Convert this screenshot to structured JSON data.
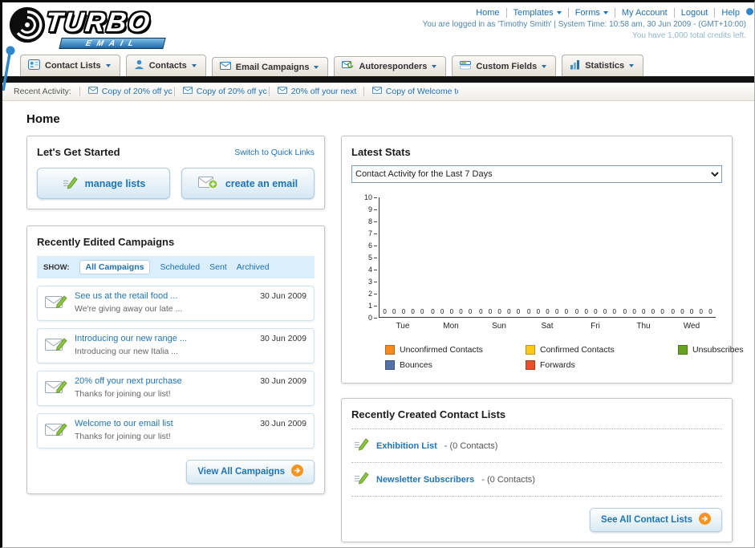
{
  "header": {
    "logo": {
      "title": "TURBO",
      "subtitle": "EMAIL"
    },
    "links": [
      {
        "label": "Home"
      },
      {
        "label": "Templates"
      },
      {
        "label": "Forms"
      },
      {
        "label": "My Account"
      },
      {
        "label": "Logout"
      },
      {
        "label": "Help"
      }
    ],
    "session_line": "You are logged in as 'Timothy Smith' | System Time: 10:58 am, 30 Jun 2009 - (GMT+10:00)",
    "credits_line": "You have 1,000 total credits left."
  },
  "nav": {
    "tabs": [
      {
        "label": "Contact Lists"
      },
      {
        "label": "Contacts"
      },
      {
        "label": "Email Campaigns"
      },
      {
        "label": "Autoresponders"
      },
      {
        "label": "Custom Fields"
      },
      {
        "label": "Statistics"
      }
    ]
  },
  "recent_activity": {
    "label": "Recent Activity:",
    "items": [
      {
        "label": "Copy of 20% off yc"
      },
      {
        "label": "Copy of 20% off yc"
      },
      {
        "label": "20% off your next"
      },
      {
        "label": "Copy of Welcome tc"
      }
    ]
  },
  "page": {
    "title": "Home"
  },
  "get_started": {
    "title": "Let's Get Started",
    "quick_links_label": "Switch to Quick Links",
    "manage_lists_label": "manage lists",
    "create_email_label": "create an email"
  },
  "campaigns": {
    "title": "Recently Edited Campaigns",
    "show_label": "SHOW:",
    "tabs": [
      {
        "label": "All Campaigns"
      },
      {
        "label": "Scheduled"
      },
      {
        "label": "Sent"
      },
      {
        "label": "Archived"
      }
    ],
    "items": [
      {
        "title": "See us at the retail food ...",
        "subtitle": "We're giving away our late ...",
        "date": "30 Jun 2009"
      },
      {
        "title": "Introducing our new range ...",
        "subtitle": "Introducing our new Italia ...",
        "date": "30 Jun 2009"
      },
      {
        "title": "20% off your next purchase",
        "subtitle": "Thanks for joining our list!",
        "date": "30 Jun 2009"
      },
      {
        "title": "Welcome to our email list",
        "subtitle": "Thanks for joining our list!",
        "date": "30 Jun 2009"
      }
    ],
    "view_all_label": "View All Campaigns"
  },
  "stats": {
    "title": "Latest Stats",
    "selected_option": "Contact Activity for the Last 7 Days",
    "chart_data": {
      "type": "bar",
      "title": "Contact Activity for the Last 7 Days",
      "categories": [
        "Tue",
        "Mon",
        "Sun",
        "Sat",
        "Fri",
        "Thu",
        "Wed"
      ],
      "series": [
        {
          "name": "Unconfirmed Contacts",
          "color": "#f68b1f",
          "values": [
            0,
            0,
            0,
            0,
            0,
            0,
            0
          ]
        },
        {
          "name": "Confirmed Contacts",
          "color": "#fdc716",
          "values": [
            0,
            0,
            0,
            0,
            0,
            0,
            0
          ]
        },
        {
          "name": "Unsubscribes",
          "color": "#66a321",
          "values": [
            0,
            0,
            0,
            0,
            0,
            0,
            0
          ]
        },
        {
          "name": "Bounces",
          "color": "#5470a8",
          "values": [
            0,
            0,
            0,
            0,
            0,
            0,
            0
          ]
        },
        {
          "name": "Forwards",
          "color": "#e8502a",
          "values": [
            0,
            0,
            0,
            0,
            0,
            0,
            0
          ]
        }
      ],
      "ylim": [
        0,
        10
      ],
      "y_step": 1,
      "grid": false,
      "legend_position": "bottom"
    }
  },
  "contact_lists": {
    "title": "Recently Created Contact Lists",
    "items": [
      {
        "name": "Exhibition List",
        "detail": "- (0 Contacts)"
      },
      {
        "name": "Newsletter Subscribers",
        "detail": "- (0 Contacts)"
      }
    ],
    "see_all_label": "See All Contact Lists"
  }
}
